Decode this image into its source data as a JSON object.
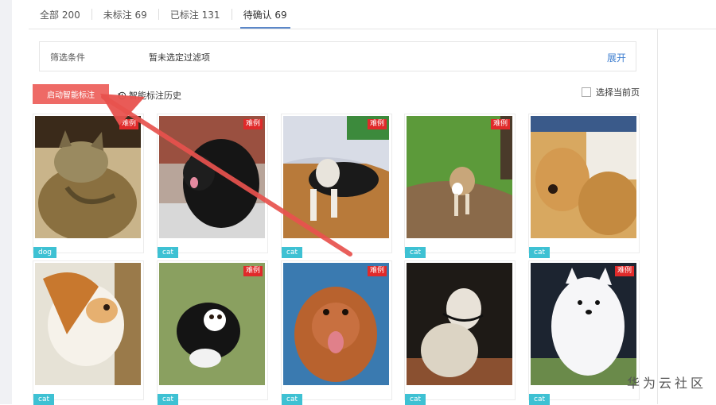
{
  "tabs": [
    {
      "label": "全部 200"
    },
    {
      "label": "未标注 69"
    },
    {
      "label": "已标注 131"
    },
    {
      "label": "待确认 69"
    }
  ],
  "filter": {
    "label": "筛选条件",
    "value": "暂未选定过滤项",
    "expand": "展开"
  },
  "toolbar": {
    "smart_button": "启动智能标注",
    "history": "智能标注历史",
    "select_page": "选择当前页"
  },
  "cards": [
    {
      "tag": "dog",
      "badge": "难例",
      "icon": "cat-photo"
    },
    {
      "tag": "cat",
      "badge": "难例",
      "icon": "dog-photo"
    },
    {
      "tag": "cat",
      "badge": "难例",
      "icon": "dog-photo"
    },
    {
      "tag": "cat",
      "badge": "难例",
      "icon": "dog-photo"
    },
    {
      "tag": "cat",
      "badge": "",
      "icon": "dog-photo"
    },
    {
      "tag": "cat",
      "badge": "",
      "icon": "dog-photo"
    },
    {
      "tag": "cat",
      "badge": "难例",
      "icon": "dog-photo"
    },
    {
      "tag": "cat",
      "badge": "难例",
      "icon": "dog-photo"
    },
    {
      "tag": "cat",
      "badge": "",
      "icon": "dog-photo"
    },
    {
      "tag": "cat",
      "badge": "难例",
      "icon": "dog-photo"
    }
  ],
  "watermark": "华为云社区",
  "colors": {
    "accent": "#ee6a66",
    "tag": "#3ec1d3",
    "badge": "#e02a2a",
    "link": "#3f7fd0",
    "arrow": "#e8524e"
  }
}
